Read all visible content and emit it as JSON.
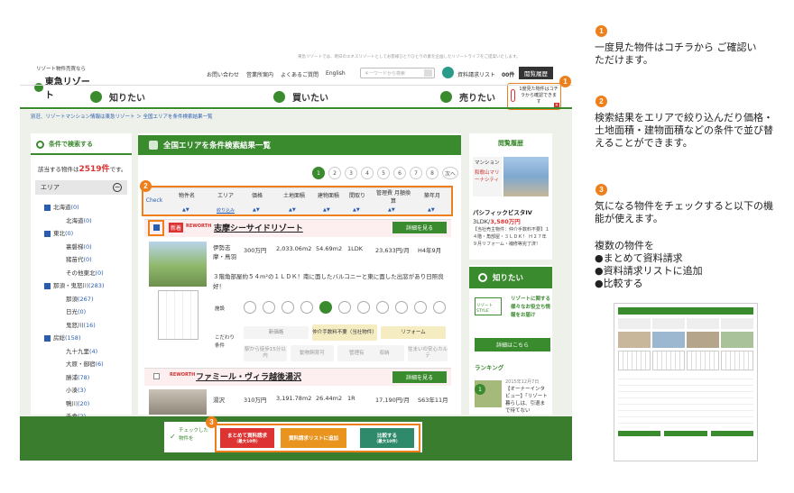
{
  "header": {
    "tagline": "東急リゾートでは、明日のエネスリゾートとしてお客様ひとりひとりの素を企画したリゾートライフをご提案いたします。",
    "logo_small": "リゾート物件売買なら",
    "logo_main": "東急リゾート",
    "links": [
      "お問い合わせ",
      "営業所案内",
      "よくあるご質問",
      "English"
    ],
    "search_placeholder": "キーワードから検索",
    "request_list": "資料請求リスト",
    "request_count": "00件",
    "history_button": "閲覧履歴",
    "history_tooltip": "1度見た物件はコチラから確認できます"
  },
  "nav": {
    "items": [
      "知りたい",
      "買いたい",
      "売りたい"
    ]
  },
  "breadcrumb": "別荘、リゾートマンション情報は東急リゾート ＞ 全国エリアを条件検索結果一覧",
  "sidebar": {
    "title": "条件で検索する",
    "count_prefix": "該当する物件は",
    "count": "2519件",
    "count_suffix": "です。",
    "area_label": "エリア",
    "areas": [
      {
        "label": "北海道",
        "count": "(0)",
        "checked": true,
        "indent": false
      },
      {
        "label": "北海道",
        "count": "(0)",
        "checked": false,
        "indent": true
      },
      {
        "label": "東北",
        "count": "(0)",
        "checked": true,
        "indent": false
      },
      {
        "label": "裏磐梯",
        "count": "(0)",
        "checked": false,
        "indent": true
      },
      {
        "label": "猪苗代",
        "count": "(0)",
        "checked": false,
        "indent": true
      },
      {
        "label": "その他東北",
        "count": "(0)",
        "checked": false,
        "indent": true
      },
      {
        "label": "那須・鬼怒川",
        "count": "(283)",
        "checked": true,
        "indent": false
      },
      {
        "label": "那須",
        "count": "(267)",
        "checked": false,
        "indent": true
      },
      {
        "label": "日光",
        "count": "(0)",
        "checked": false,
        "indent": true
      },
      {
        "label": "鬼怒川",
        "count": "(16)",
        "checked": false,
        "indent": true
      },
      {
        "label": "房総",
        "count": "(158)",
        "checked": true,
        "indent": false
      },
      {
        "label": "九十九里",
        "count": "(4)",
        "checked": false,
        "indent": true
      },
      {
        "label": "大原・御宿",
        "count": "(6)",
        "checked": false,
        "indent": true
      },
      {
        "label": "勝浦",
        "count": "(78)",
        "checked": false,
        "indent": true
      },
      {
        "label": "小湊",
        "count": "(3)",
        "checked": false,
        "indent": true
      },
      {
        "label": "鴨川",
        "count": "(20)",
        "checked": false,
        "indent": true
      },
      {
        "label": "千倉",
        "count": "(2)",
        "checked": false,
        "indent": true
      }
    ]
  },
  "main": {
    "title": "全国エリアを条件検索結果一覧",
    "pages": [
      "1",
      "2",
      "3",
      "4",
      "5",
      "6",
      "7",
      "8",
      "次へ"
    ],
    "columns": [
      "Check",
      "物件名",
      "エリア",
      "価格",
      "土地面積",
      "建物面積",
      "間取り",
      "管理費 月額換算",
      "築年月"
    ],
    "area_sort": "絞り込み",
    "sort_arrows": "▲▼"
  },
  "listing1": {
    "badge": "新着",
    "brand": "REWORTH",
    "name": "志摩シーサイドリゾート",
    "detail": "詳細を見る",
    "area": "伊勢志摩・鳥羽",
    "price": "300万円",
    "land": "2,033.06m2",
    "building": "54.69m2",
    "layout": "1LDK",
    "fee": "23,633円/月",
    "built": "H4年9月",
    "desc": "３階角部屋約５４m²の１ＬＤＫ！南に面したバルコニーと東に面した出窓があり日照良好！",
    "facility_label": "施設",
    "kodawari_label": "こだわり条件",
    "tags": [
      "新価格",
      "仲介手数料不要（当社物件）",
      "リフォーム",
      "駅から徒歩15分以内",
      "動物飼育可",
      "管理有り",
      "収納",
      "住まいの安心カルテ"
    ]
  },
  "listing2": {
    "brand": "REWORTH",
    "name": "ファミール・ヴィラ越後湯沢",
    "detail": "詳細を見る",
    "area": "湯沢",
    "price": "310万円",
    "land": "3,191.78m2",
    "building": "26.44m2",
    "layout": "1R",
    "fee": "17,190円/月",
    "built": "S63年11月"
  },
  "right": {
    "history_title": "閲覧履歴",
    "mansion_label": "マンション",
    "mansion_text": "和歌山マリーナシティ",
    "prop_name": "パシフィックビスタIV",
    "prop_price_layout": "3LDK/",
    "prop_price": "3,580万円",
    "prop_desc": "【当社売主物件：仲介手数料不要】１４階・角部屋・３ＬＤＫ！ Ｈ２７年９月リフォーム・補修等完了済！",
    "know_title": "知りたい",
    "style_label": "リゾートSTYLE",
    "style_text": "リゾートに関する様々なお役立ち情報をお届け",
    "detail_button": "詳細はこちら",
    "ranking": "ランキング",
    "rank_date": "2015年12月7日",
    "rank_text": "【オーナーインタビュー】「リゾート暮らしは、引退まで待てない"
  },
  "footer": {
    "checked_label": "チェックした物件を",
    "btn1": "まとめて資料請求",
    "btn1_sub": "（最大10件）",
    "btn2": "資料請求リストに追加",
    "btn3": "比較する",
    "btn3_sub": "（最大10件）"
  },
  "annotations": {
    "n1": "1",
    "n2": "2",
    "n3": "3",
    "t1": "一度見た物件はコチラから ご確認いただけます。",
    "t2": "検索結果をエリアで絞り込んだり価格・土地面積・建物面積などの条件で並び替えることができます。",
    "t3": "気になる物件をチェックすると以下の機能が使えます。",
    "t4_title": "複数の物件を",
    "t4_items": [
      "●まとめて資料請求",
      "●資料請求リストに追加",
      "●比較する"
    ]
  }
}
